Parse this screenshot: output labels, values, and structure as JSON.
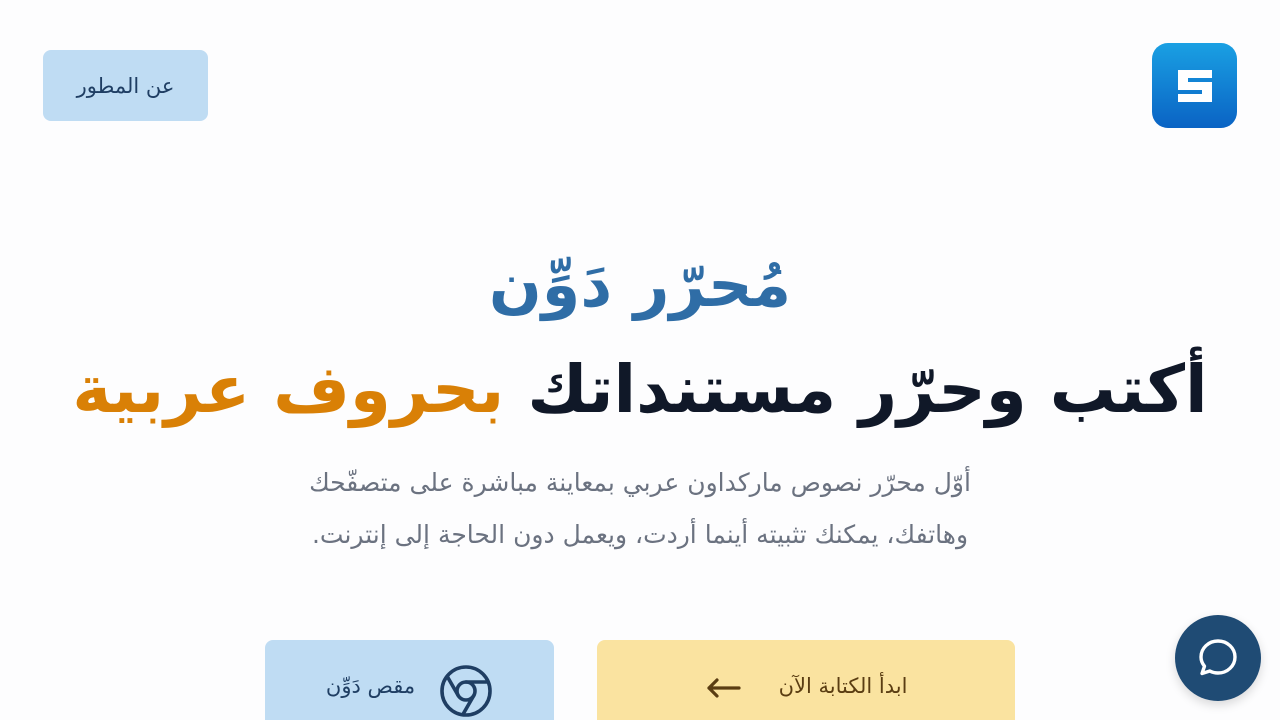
{
  "header": {
    "logo_icon": "daween-logo-icon",
    "about_label": "عن المطور"
  },
  "hero": {
    "app_name": "مُحرّر دَوِّن",
    "headline_main": "أكتب وحرّر مستنداتك",
    "headline_accent": "بحروف عربية",
    "subtitle_line1": "أوّل محرّر نصوص ماركداون عربي بمعاينة مباشرة على متصفّحك",
    "subtitle_line2": "وهاتفك، يمكنك تثبيته أينما أردت، ويعمل دون الحاجة إلى إنترنت."
  },
  "actions": {
    "start_label": "ابدأ الكتابة الآن",
    "start_icon": "arrow-left-icon",
    "extension_label": "مقص دَوِّن",
    "extension_icon": "chrome-icon"
  },
  "chat": {
    "icon": "chat-bubble-icon"
  },
  "colors": {
    "accent_blue": "#2f6da6",
    "accent_orange": "#d98006",
    "button_blue": "#bfdcf3",
    "button_yellow": "#fae3a0",
    "chat_bg": "#1f4b74"
  }
}
